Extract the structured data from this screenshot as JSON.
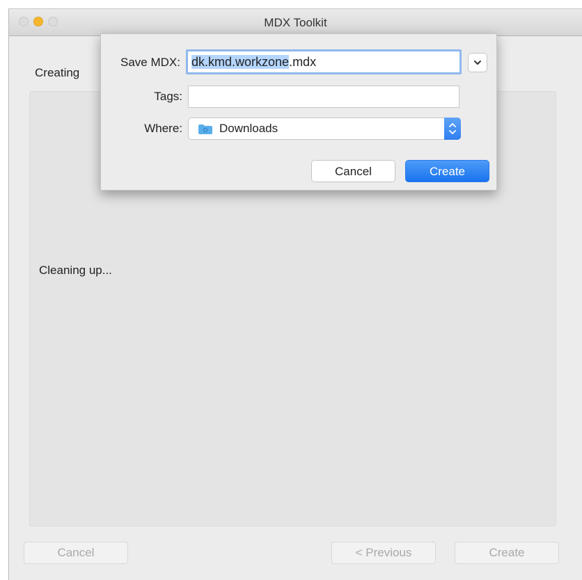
{
  "window": {
    "title": "MDX Toolkit"
  },
  "main": {
    "heading": "Creating",
    "status": "Cleaning up..."
  },
  "footer": {
    "cancel_label": "Cancel",
    "previous_label": "< Previous",
    "create_label": "Create"
  },
  "save_sheet": {
    "name_label": "Save MDX:",
    "name_value_selected": "dk.kmd.workzone",
    "name_value_ext": ".mdx",
    "tags_label": "Tags:",
    "tags_value": "",
    "where_label": "Where:",
    "where_value": "Downloads",
    "where_icon": "folder-icon",
    "cancel_label": "Cancel",
    "create_label": "Create"
  },
  "colors": {
    "accent": "#1a74ee",
    "selection": "#b4d5fe",
    "minimize_light": "#f6b72c"
  }
}
